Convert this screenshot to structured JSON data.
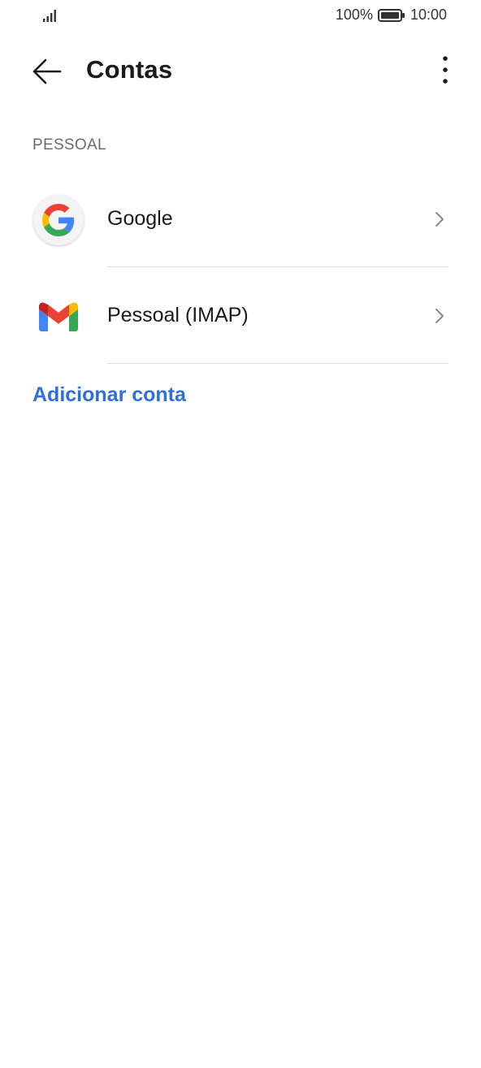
{
  "status_bar": {
    "battery_percent": "100%",
    "time": "10:00",
    "signal_icon": "signal-bars-icon",
    "battery_icon": "battery-icon"
  },
  "app_bar": {
    "title": "Contas",
    "back_icon": "arrow-left-icon",
    "menu_icon": "more-vertical-icon"
  },
  "section": {
    "title": "PESSOAL"
  },
  "accounts": [
    {
      "label": "Google",
      "icon": "google-icon"
    },
    {
      "label": "Pessoal (IMAP)",
      "icon": "gmail-icon"
    }
  ],
  "add_account": {
    "label": "Adicionar conta"
  },
  "colors": {
    "accent": "#2e6fd9",
    "google_blue": "#4285F4",
    "google_red": "#EA4335",
    "google_yellow": "#FBBC05",
    "google_green": "#34A853"
  }
}
